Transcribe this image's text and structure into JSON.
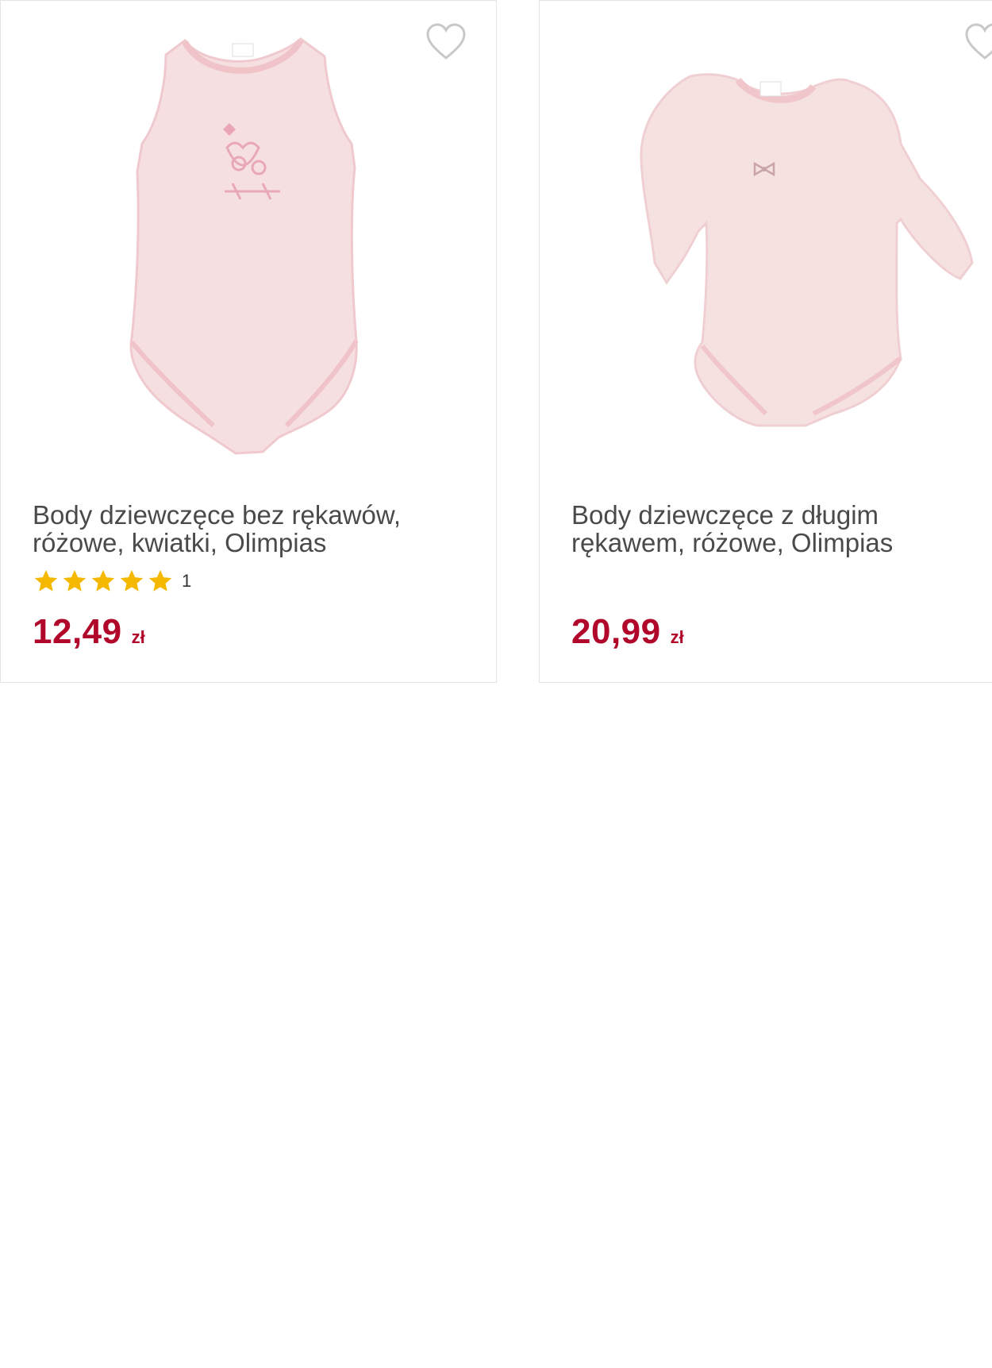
{
  "products": [
    {
      "title_line1": "Body dziewczęce bez rękawów,",
      "title_line2": "różowe, kwiatki, Olimpias",
      "rating_stars": 5,
      "rating_count": "1",
      "price": "12,49",
      "currency": "zł",
      "image_icon": "sleeveless-bodysuit-image"
    },
    {
      "title_line1": "Body dziewczęce z długim",
      "title_line2": "rękawem, różowe, Olimpias",
      "price": "20,99",
      "currency": "zł",
      "image_icon": "long-sleeve-bodysuit-image"
    }
  ],
  "colors": {
    "price": "#b0072a",
    "star": "#f5b800",
    "garment": "#f6dfe0",
    "heart_outline": "#c8c8c8"
  }
}
